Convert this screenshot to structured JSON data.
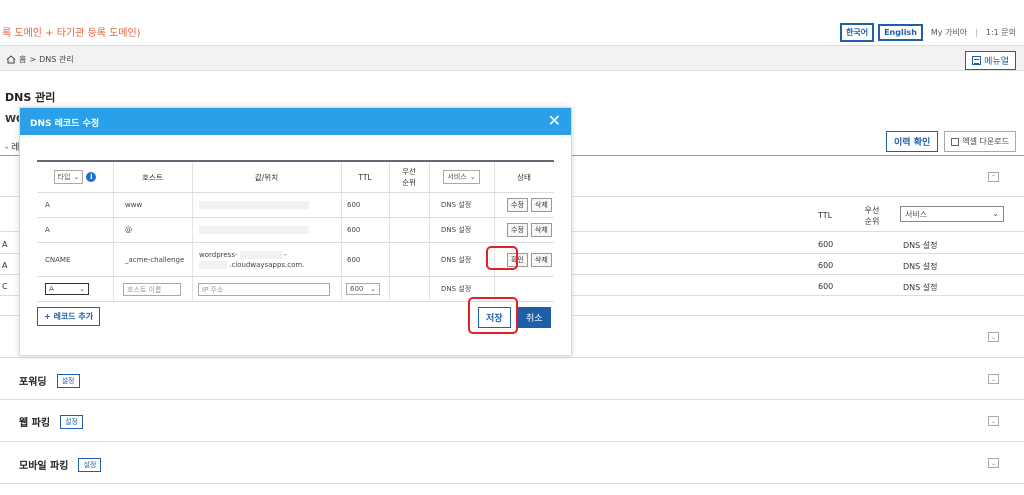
{
  "header": {
    "title": "록 도메인 + 타기관 등록 도메인)",
    "lang_ko": "한국어",
    "lang_en": "English",
    "my_gabia": "My 가비아",
    "divider": "|",
    "inquiry": "1:1 문의"
  },
  "breadcrumb": {
    "home": "홈",
    "sep": ">",
    "current": "DNS 관리",
    "manual_label": "메뉴얼"
  },
  "page": {
    "title": "DNS 관리",
    "frag_domain": "WO",
    "frag_dash": "- 레"
  },
  "background": {
    "history_btn": "이력 확인",
    "excel_btn": "엑셀 다운로드",
    "col_ttl": "TTL",
    "col_priority": "우선 순위",
    "service_select": "서비스",
    "rows": [
      {
        "prefix": "A",
        "ttl": "600",
        "service": "DNS 설정"
      },
      {
        "prefix": "A",
        "ttl": "600",
        "service": "DNS 설정"
      },
      {
        "prefix": "C",
        "ttl": "600",
        "service": "DNS 설정"
      }
    ],
    "sections": [
      {
        "label": "포워딩",
        "button": "설정"
      },
      {
        "label": "웹 파킹",
        "button": "설정"
      },
      {
        "label": "모바일 파킹",
        "button": "설정"
      }
    ]
  },
  "modal": {
    "title": "DNS 레코드 수정",
    "close_icon": "close-icon",
    "columns": {
      "type": "타입",
      "host": "호스트",
      "value": "값/위치",
      "ttl": "TTL",
      "priority": "우선 순위",
      "service": "서비스",
      "status": "상태"
    },
    "rows": [
      {
        "type": "A",
        "host": "www",
        "value": "",
        "ttl": "600",
        "service": "DNS 설정",
        "btn1": "수정",
        "btn2": "삭제"
      },
      {
        "type": "A",
        "host": "@",
        "value": "",
        "ttl": "600",
        "service": "DNS 설정",
        "btn1": "수정",
        "btn2": "삭제"
      },
      {
        "type": "CNAME",
        "host": "_acme-challenge",
        "value_line1": "wordpress-",
        "value_line1_tail": "-",
        "value_line2": ".cloudwaysapps.com.",
        "ttl": "600",
        "service": "DNS 설정",
        "btn1": "확인",
        "btn2": "삭제"
      }
    ],
    "new_row": {
      "type": "A",
      "host_placeholder": "호스트 이름",
      "value_placeholder": "IP 주소",
      "ttl": "600",
      "service": "DNS 설정"
    },
    "add_record": "+ 레코드 추가",
    "save": "저장",
    "cancel": "취소"
  },
  "colors": {
    "accent": "#1f5fa8",
    "modal_header": "#2aa0e8",
    "highlight": "#e3202a",
    "title_orange": "#e5603c"
  }
}
